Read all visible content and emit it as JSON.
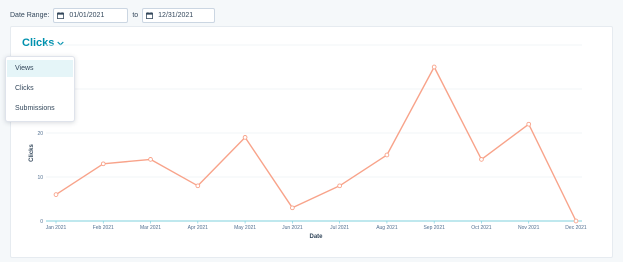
{
  "date_range": {
    "label": "Date Range:",
    "start": "01/01/2021",
    "separator": "to",
    "end": "12/31/2021"
  },
  "metric_selector": {
    "label": "Clicks",
    "icon": "chevron-down-icon",
    "options": [
      "Views",
      "Clicks",
      "Submissions"
    ],
    "highlighted": "Views"
  },
  "colors": {
    "line": "#f8a38a",
    "accent": "#0091ae",
    "axis": "#7fd1de"
  },
  "chart_data": {
    "type": "line",
    "categories": [
      "Jan 2021",
      "Feb 2021",
      "Mar 2021",
      "Apr 2021",
      "May 2021",
      "Jun 2021",
      "Jul 2021",
      "Aug 2021",
      "Sep 2021",
      "Oct 2021",
      "Nov 2021",
      "Dec 2021"
    ],
    "series": [
      {
        "values": [
          6,
          13,
          14,
          8,
          19,
          3,
          8,
          15,
          35,
          14,
          22,
          0
        ]
      }
    ],
    "xlabel": "Date",
    "ylabel": "Clicks",
    "yticks": [
      0,
      10,
      20
    ],
    "ylim": [
      0,
      40
    ],
    "grid": true,
    "legend": "none"
  }
}
